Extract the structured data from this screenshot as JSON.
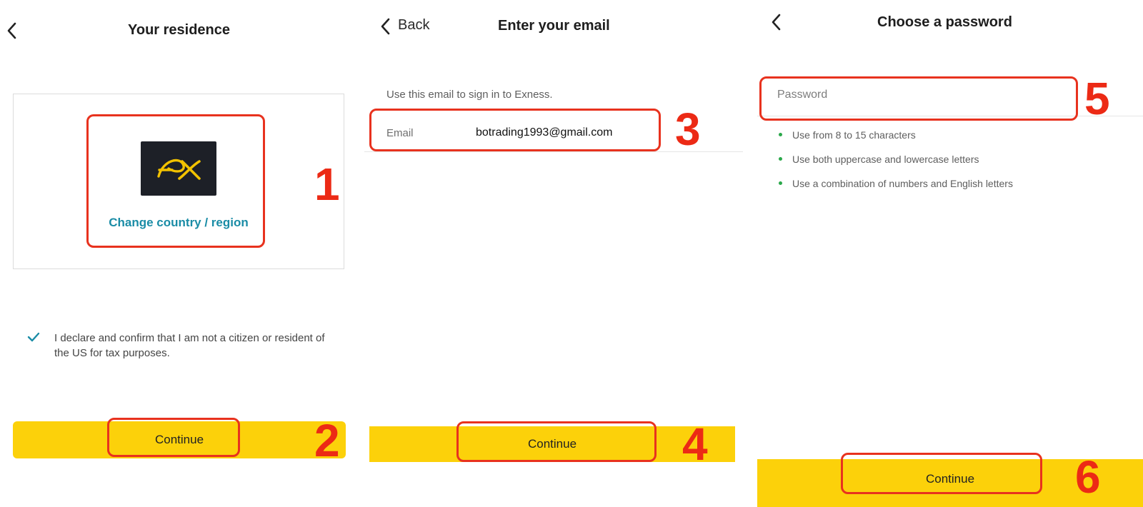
{
  "screen1": {
    "title": "Your residence",
    "change_country_label": "Change country / region",
    "declaration": "I declare and confirm that I am not a citizen or resident of the US for tax purposes.",
    "continue_label": "Continue"
  },
  "screen2": {
    "back_label": "Back",
    "title": "Enter your email",
    "hint": "Use this email to sign in to Exness.",
    "email_label": "Email",
    "email_value": "botrading1993@gmail.com",
    "continue_label": "Continue"
  },
  "screen3": {
    "title": "Choose a password",
    "password_placeholder": "Password",
    "rules": [
      "Use from 8 to 15 characters",
      "Use both uppercase and lowercase letters",
      "Use a combination of numbers and English letters"
    ],
    "continue_label": "Continue"
  },
  "annotations": {
    "steps": [
      "1",
      "2",
      "3",
      "4",
      "5",
      "6"
    ],
    "color": "#e8321e"
  },
  "colors": {
    "accent_yellow": "#fcd10a",
    "link_teal": "#1a8ca6",
    "rule_bullet_green": "#2aa84a",
    "logo_bg": "#1d2027",
    "logo_gold": "#f2c200"
  },
  "icons": {
    "back": "chevron-left-icon",
    "check": "checkmark-icon",
    "logo": "exness-logo"
  }
}
